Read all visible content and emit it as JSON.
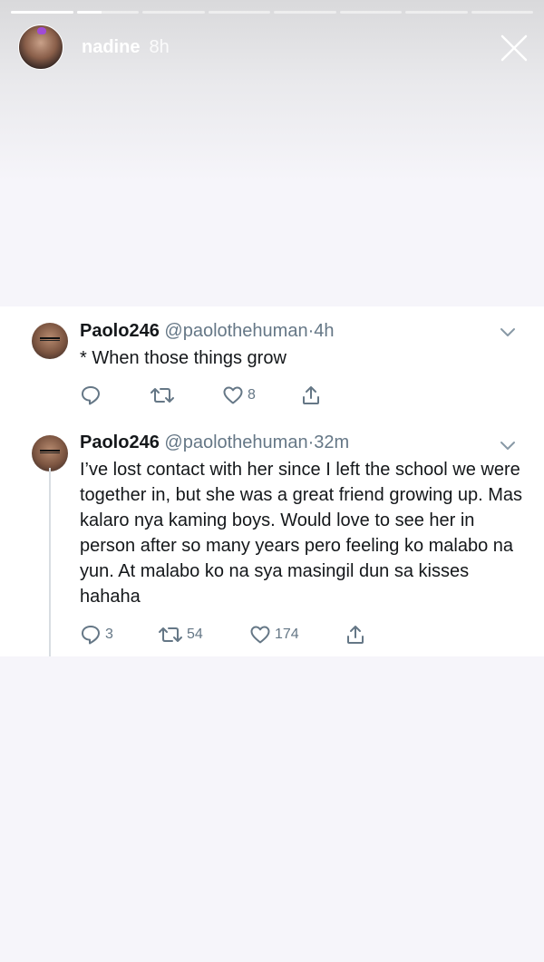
{
  "story": {
    "username": "nadine",
    "time": "8h",
    "progress": [
      1,
      0.4,
      0,
      0,
      0,
      0,
      0,
      0
    ]
  },
  "tweets": [
    {
      "name": "Paolo246",
      "handle": "@paolothehuman",
      "dot": "·",
      "time": "4h",
      "text": "* When those things grow",
      "replies": "",
      "retweets": "",
      "likes": "8"
    },
    {
      "name": "Paolo246",
      "handle": "@paolothehuman",
      "dot": "·",
      "time": "32m",
      "text": "I’ve lost contact with her since I left the school we were together in, but she was a great friend growing up. Mas kalaro nya kaming boys. Would love to see her in person after so many years pero feeling ko malabo na yun. At malabo ko na sya masingil dun sa kisses hahaha",
      "replies": "3",
      "retweets": "54",
      "likes": "174"
    }
  ],
  "icons": {
    "reply": "reply-icon",
    "retweet": "retweet-icon",
    "like": "heart-icon",
    "share": "share-icon",
    "close": "close-icon",
    "chevron": "chevron-down-icon"
  },
  "colors": {
    "text": "#14171a",
    "muted": "#657786",
    "background": "#f6f5fa"
  }
}
